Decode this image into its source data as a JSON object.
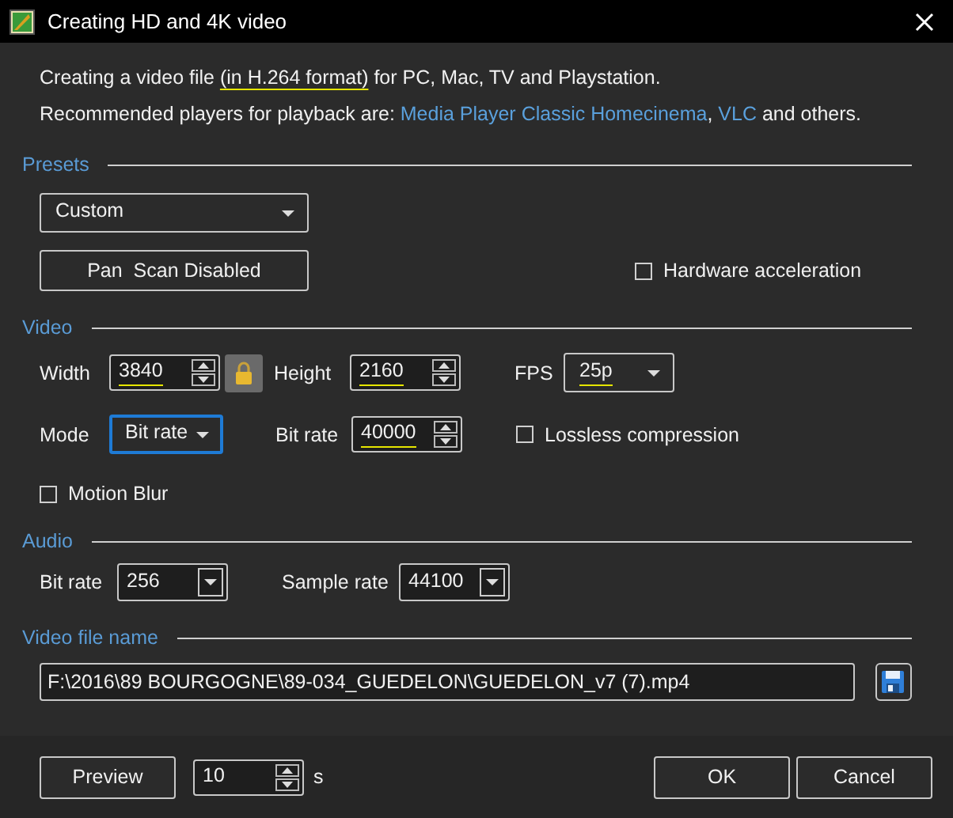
{
  "window": {
    "title": "Creating HD and 4K video"
  },
  "intro": [
    {
      "segments": [
        {
          "kind": "text",
          "text": "Creating a video file ",
          "underlined": false
        },
        {
          "kind": "text",
          "text": "(in H.264 format)",
          "underlined": true
        },
        {
          "kind": "text",
          "text": " for PC, Mac, TV and Playstation.",
          "underlined": false
        }
      ]
    },
    {
      "segments": [
        {
          "kind": "text",
          "text": "Recommended players for playback are: ",
          "underlined": false
        },
        {
          "kind": "link",
          "text": "Media Player Classic Homecinema",
          "underlined": false
        },
        {
          "kind": "text",
          "text": ", ",
          "underlined": false
        },
        {
          "kind": "link",
          "text": "VLC",
          "underlined": false
        },
        {
          "kind": "text",
          "text": " and others.",
          "underlined": false
        }
      ]
    }
  ],
  "presets": {
    "title": "Presets",
    "preset": {
      "value": "Custom"
    },
    "pan_scan_button": "Pan  Scan Disabled",
    "hardware_acceleration": {
      "label": "Hardware acceleration",
      "checked": false
    }
  },
  "video": {
    "title": "Video",
    "width": {
      "label": "Width",
      "value": "3840",
      "underlined": true
    },
    "aspect_locked": true,
    "height": {
      "label": "Height",
      "value": "2160",
      "underlined": true
    },
    "fps": {
      "label": "FPS",
      "value": "25p",
      "underlined": true
    },
    "mode": {
      "label": "Mode",
      "value": "Bit rate",
      "focused": true
    },
    "bit_rate": {
      "label": "Bit rate",
      "value": "40000",
      "underlined": true
    },
    "lossless_compression": {
      "label": "Lossless compression",
      "checked": false
    },
    "motion_blur": {
      "label": "Motion Blur",
      "checked": false
    }
  },
  "audio": {
    "title": "Audio",
    "bit_rate": {
      "label": "Bit rate",
      "value": "256"
    },
    "sample_rate": {
      "label": "Sample rate",
      "value": "44100"
    }
  },
  "output": {
    "title": "Video file name",
    "file_name": "F:\\2016\\89 BOURGOGNE\\89-034_GUEDELON\\GUEDELON_v7 (7).mp4"
  },
  "footer": {
    "preview_button": "Preview",
    "preview_seconds": "10",
    "seconds_unit": "s",
    "ok_button": "OK",
    "cancel_button": "Cancel"
  }
}
